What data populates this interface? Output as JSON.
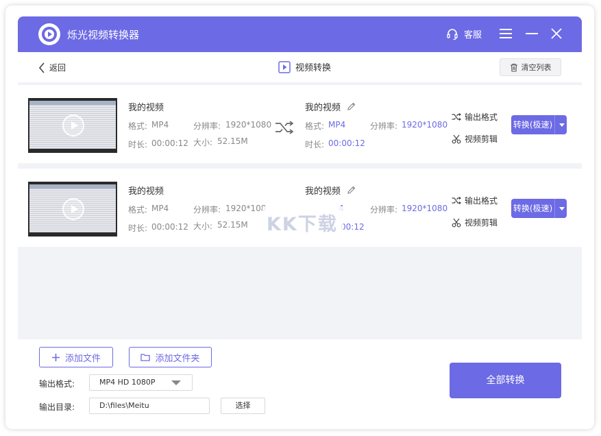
{
  "titlebar": {
    "app_title": "烁光视频转换器",
    "service_label": "客服"
  },
  "nav": {
    "back_label": "返回",
    "page_title": "视频转换",
    "clear_label": "清空列表"
  },
  "items": [
    {
      "source": {
        "name": "我的视频",
        "format_label": "格式:",
        "format": "MP4",
        "resolution_label": "分辨率:",
        "resolution": "1920*1080",
        "duration_label": "时长:",
        "duration": "00:00:12",
        "size_label": "大小:",
        "size": "52.15M"
      },
      "target": {
        "name": "我的视频",
        "format_label": "格式:",
        "format": "MP4",
        "resolution_label": "分辨率:",
        "resolution": "1920*1080",
        "duration_label": "时长:",
        "duration": "00:00:12"
      },
      "actions": {
        "output_format": "输出格式",
        "edit": "视频剪辑",
        "convert": "转换(极速)"
      }
    },
    {
      "source": {
        "name": "我的视频",
        "format_label": "格式:",
        "format": "MP4",
        "resolution_label": "分辨率:",
        "resolution": "1920*108",
        "duration_label": "时长:",
        "duration": "00:00:12",
        "size_label": "大小:",
        "size": "52.15M"
      },
      "target": {
        "name": "我的视频",
        "format_label": "",
        "format": "4",
        "resolution_label": "分辨率:",
        "resolution": "1920*1080",
        "duration_label": "",
        "duration": "00:12"
      },
      "actions": {
        "output_format": "输出格式",
        "edit": "视频剪辑",
        "convert": "转换(极速)"
      }
    }
  ],
  "watermark": "KK下载",
  "bottom": {
    "add_file": "添加文件",
    "add_folder": "添加文件夹",
    "output_format_label": "输出格式:",
    "output_format_value": "MP4 HD 1080P",
    "output_dir_label": "输出目录:",
    "output_dir_value": "D:\\files\\Meitu",
    "choose_label": "选择",
    "convert_all": "全部转换"
  },
  "colors": {
    "accent": "#6c6ae4",
    "list_bg": "#f2f3f7"
  }
}
